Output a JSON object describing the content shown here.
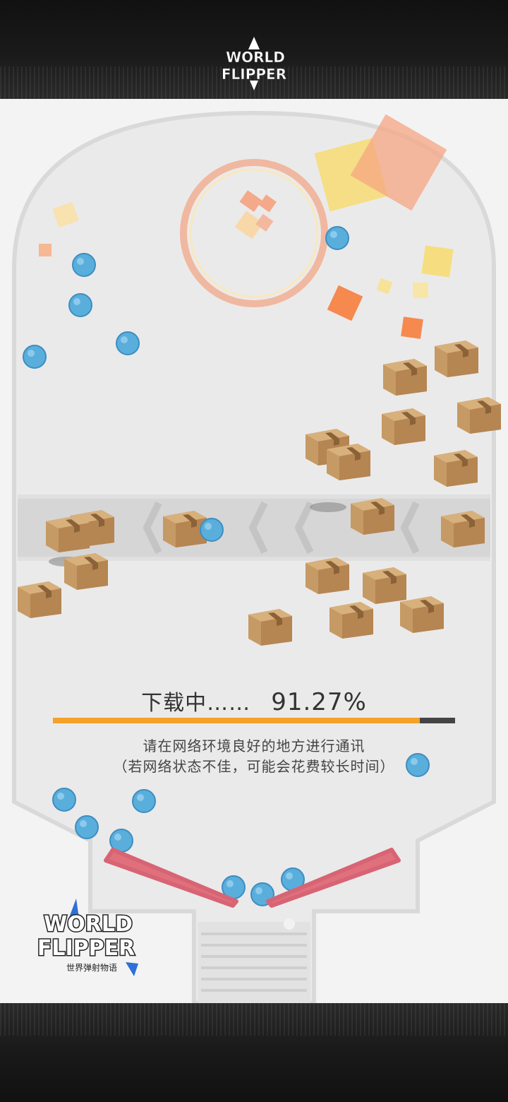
{
  "header": {
    "logo_text_line1": "WORLD",
    "logo_text_line2": "FLIPPER"
  },
  "loading": {
    "label": "下载中……",
    "percent_text": "91.27%",
    "progress": 0.9127,
    "notice_line1": "请在网络环境良好的地方进行通讯",
    "notice_line2": "（若网络状态不佳，可能会花费较长时间）"
  },
  "corner_logo": {
    "line1": "WORLD",
    "line2": "FLIPPER",
    "subtitle": "世界弹射物语"
  },
  "colors": {
    "progress_fill": "#f4a22a",
    "progress_track": "#444444",
    "ball": "#5aaedc",
    "flipper": "#e0707c",
    "box": "#c69a64"
  },
  "icons": [
    "world-flipper-logo",
    "pinball-ball",
    "cardboard-box",
    "flipper-paddle"
  ]
}
